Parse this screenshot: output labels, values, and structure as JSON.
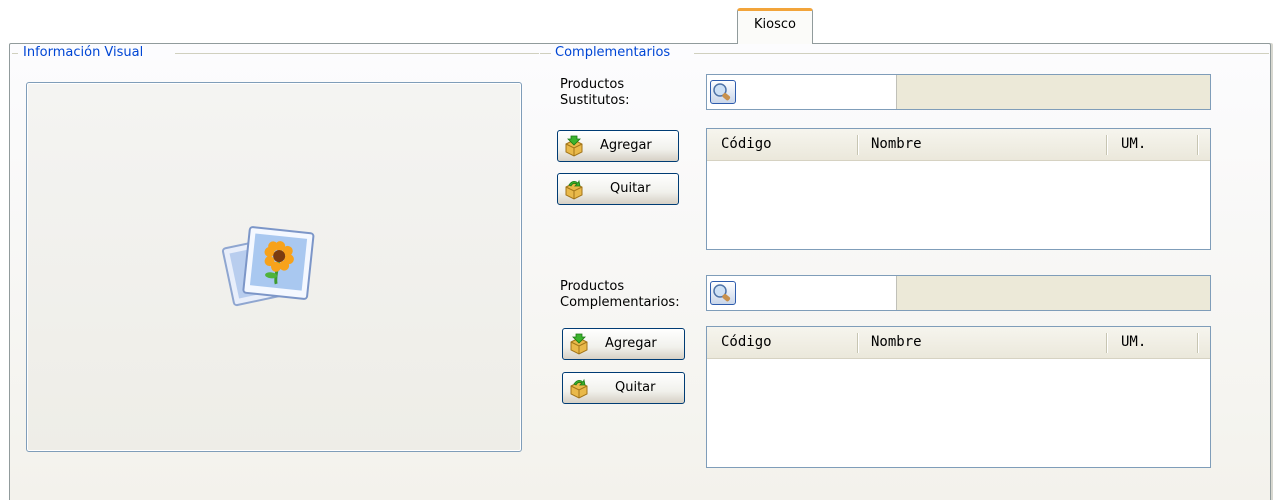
{
  "tab": {
    "label": "Kiosco"
  },
  "groups": {
    "visual": "Información Visual",
    "complementarios": "Complementarios"
  },
  "sustitutos": {
    "label_line1": "Productos",
    "label_line2": "Sustitutos:",
    "add_label": "Agregar",
    "remove_label": "Quitar",
    "columns": [
      "Código",
      "Nombre",
      "UM."
    ]
  },
  "complementarios": {
    "label_line1": "Productos",
    "label_line2": "Complementarios:",
    "add_label": "Agregar",
    "remove_label": "Quitar",
    "columns": [
      "Código",
      "Nombre",
      "UM."
    ]
  },
  "icons": {
    "image_placeholder": "picture-icon",
    "lookup": "search-icon",
    "add": "add-box-icon",
    "remove": "remove-box-icon"
  }
}
